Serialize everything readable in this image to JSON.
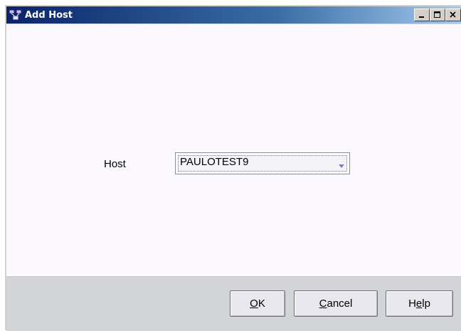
{
  "window": {
    "title": "Add Host",
    "icon": "network-hosts-icon",
    "controls": {
      "minimize_icon": "minimize-icon",
      "maximize_icon": "maximize-icon",
      "close_icon": "close-icon"
    }
  },
  "form": {
    "host_label": "Host",
    "host_value": "PAULOTEST9",
    "host_dropdown_icon": "chevron-down-icon"
  },
  "buttons": {
    "ok": {
      "mnemonic": "O",
      "rest": "K"
    },
    "cancel": {
      "mnemonic": "C",
      "rest": "ancel"
    },
    "help": {
      "prefix": "H",
      "mnemonic": "e",
      "rest": "lp"
    }
  },
  "colors": {
    "titlebar_start": "#0a246a",
    "titlebar_end": "#a6caf0",
    "content_bg": "#fbf9fd",
    "footer_bg": "#d3d4d8",
    "dropdown_arrow": "#7b7bd6"
  }
}
